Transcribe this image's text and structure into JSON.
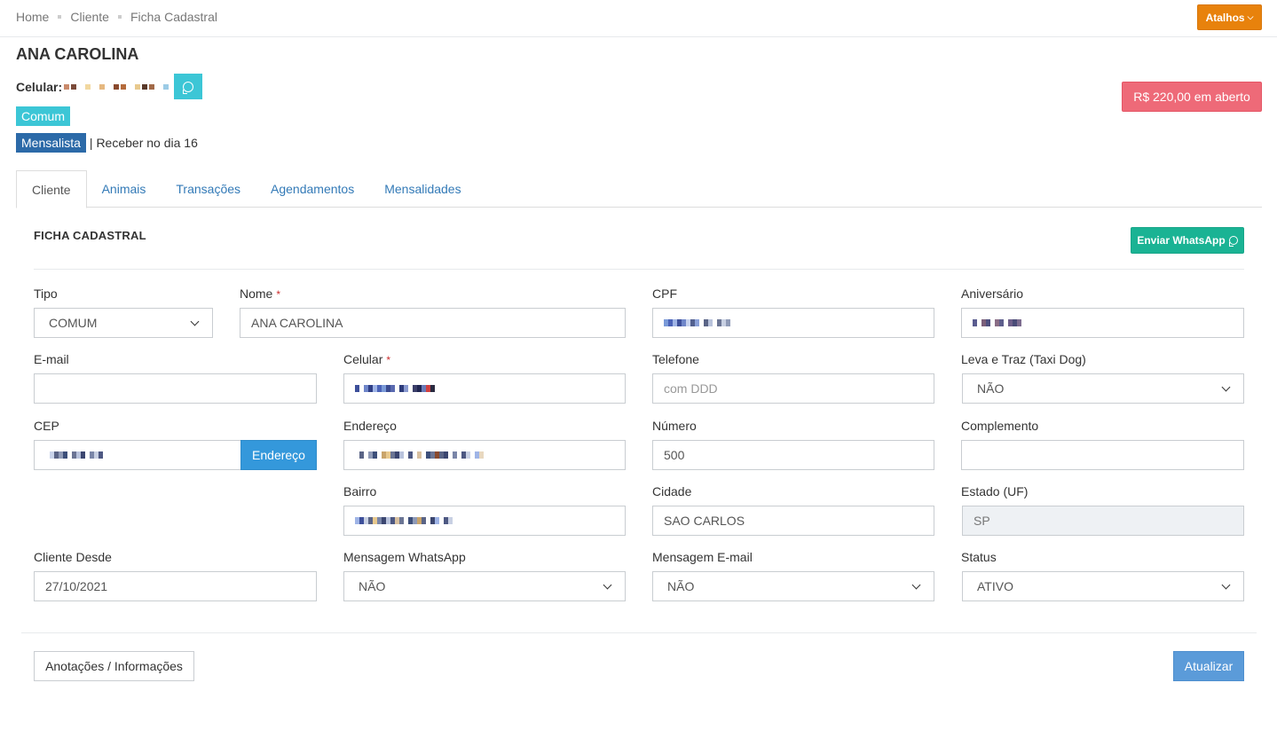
{
  "breadcrumb": [
    "Home",
    "Cliente",
    "Ficha Cadastral"
  ],
  "header": {
    "shortcuts_label": "Atalhos",
    "client_name": "ANA CAROLINA",
    "celular_label": "Celular:",
    "type_badge": "Comum",
    "mensalista_badge": "Mensalista",
    "mensalista_info": "| Receber no dia 16",
    "open_amount": "R$ 220,00 em aberto"
  },
  "tabs": [
    {
      "label": "Cliente",
      "active": true
    },
    {
      "label": "Animais",
      "active": false
    },
    {
      "label": "Transações",
      "active": false
    },
    {
      "label": "Agendamentos",
      "active": false
    },
    {
      "label": "Mensalidades",
      "active": false
    }
  ],
  "form": {
    "section_title": "FICHA CADASTRAL",
    "send_whatsapp_label": "Enviar WhatsApp",
    "tipo": {
      "label": "Tipo",
      "value": "COMUM"
    },
    "nome": {
      "label": "Nome",
      "value": "ANA CAROLINA",
      "required": "*"
    },
    "cpf": {
      "label": "CPF"
    },
    "aniversario": {
      "label": "Aniversário"
    },
    "email": {
      "label": "E-mail",
      "value": ""
    },
    "celular": {
      "label": "Celular",
      "required": "*"
    },
    "telefone": {
      "label": "Telefone",
      "value": "",
      "placeholder": "com DDD"
    },
    "leva_traz": {
      "label": "Leva e Traz (Taxi Dog)",
      "value": "NÃO"
    },
    "cep": {
      "label": "CEP",
      "button": "Endereço"
    },
    "endereco": {
      "label": "Endereço"
    },
    "numero": {
      "label": "Número",
      "value": "500"
    },
    "complemento": {
      "label": "Complemento",
      "value": ""
    },
    "bairro": {
      "label": "Bairro"
    },
    "cidade": {
      "label": "Cidade",
      "value": "SAO CARLOS"
    },
    "estado": {
      "label": "Estado (UF)",
      "value": "SP"
    },
    "cliente_desde": {
      "label": "Cliente Desde",
      "value": "27/10/2021"
    },
    "msg_whatsapp": {
      "label": "Mensagem WhatsApp",
      "value": "NÃO"
    },
    "msg_email": {
      "label": "Mensagem E-mail",
      "value": "NÃO"
    },
    "status": {
      "label": "Status",
      "value": "ATIVO"
    }
  },
  "footer": {
    "notes_label": "Anotações / Informações",
    "update_label": "Atualizar"
  },
  "colors": {
    "shortcuts": "#e8820c",
    "open_amount": "#ee6a78",
    "whatsapp": "#1ab394",
    "badge_comum": "#3cc6d6",
    "badge_mensalista": "#2c6aa8",
    "link": "#337ab7",
    "update": "#5b9bd9"
  }
}
